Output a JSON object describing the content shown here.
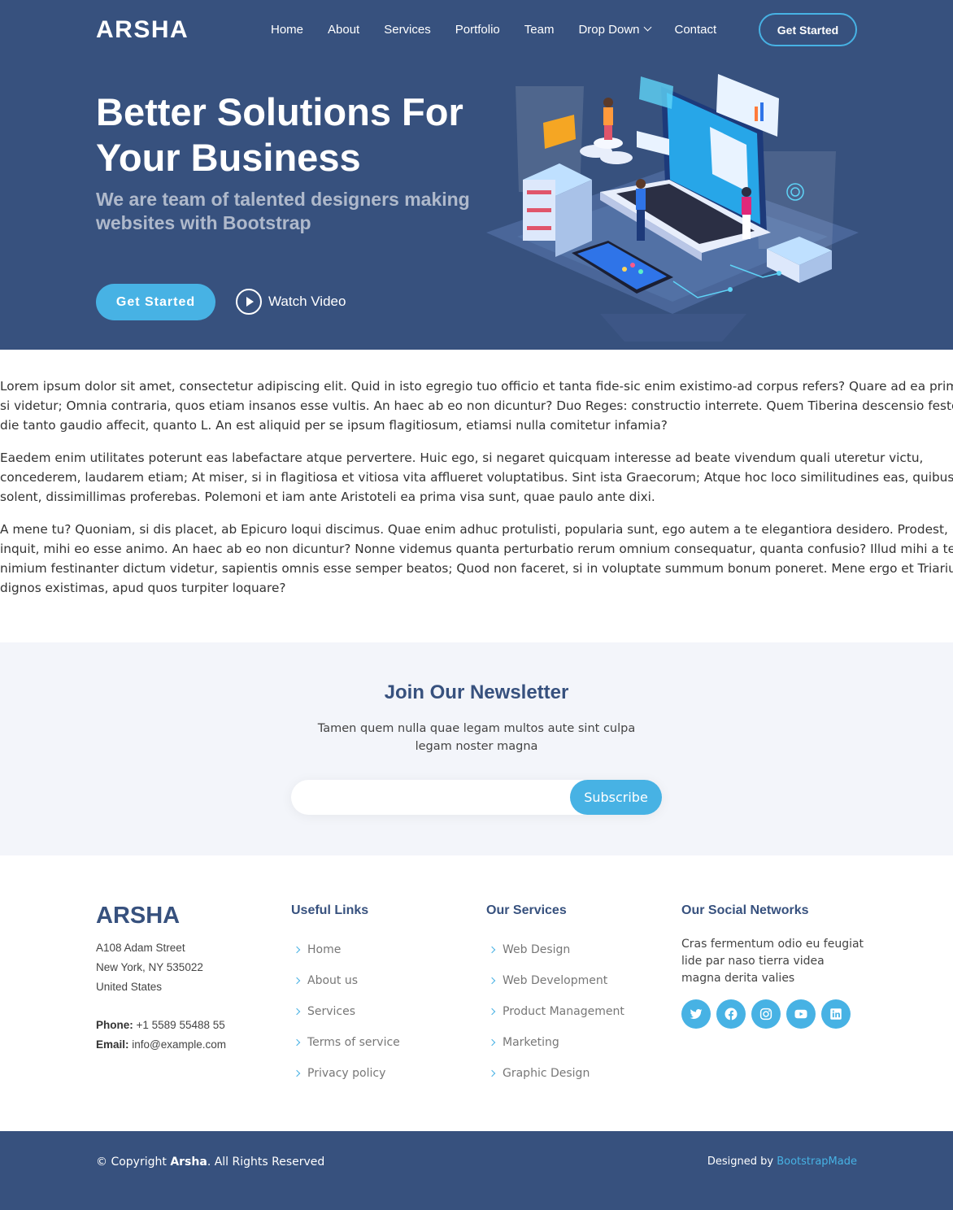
{
  "header": {
    "logo": "ARSHA",
    "nav": [
      {
        "label": "Home"
      },
      {
        "label": "About"
      },
      {
        "label": "Services"
      },
      {
        "label": "Portfolio"
      },
      {
        "label": "Team"
      },
      {
        "label": "Drop Down"
      },
      {
        "label": "Contact"
      }
    ],
    "cta": "Get Started"
  },
  "hero": {
    "title": "Better Solutions For Your Business",
    "subtitle": "We are team of talented designers making websites with Bootstrap",
    "primary_button": "Get Started",
    "video_button": "Watch Video"
  },
  "content": {
    "paragraphs": [
      [
        "Lorem ipsum dolor sit amet, consectetur adipiscing elit. Quid in isto egregio tuo officio et tanta fide-sic enim existimo-ad corpus refers? Quare ad ea primum,",
        "si videtur; Omnia contraria, quos etiam insanos esse vultis. An haec ab eo non dicuntur? Duo Reges: constructio interrete. Quem Tiberina descensio festo illo",
        "die tanto gaudio affecit, quanto L. An est aliquid per se ipsum flagitiosum, etiamsi nulla comitetur infamia?"
      ],
      [
        "Eaedem enim utilitates poterunt eas labefactare atque pervertere. Huic ego, si negaret quicquam interesse ad beate vivendum quali uteretur victu,",
        "concederem, laudarem etiam; At miser, si in flagitiosa et vitiosa vita afflueret voluptatibus. Sint ista Graecorum; Atque hoc loco similitudines eas, quibus illi uti",
        "solent, dissimillimas proferebas. Polemoni et iam ante Aristoteli ea prima visa sunt, quae paulo ante dixi."
      ],
      [
        "A mene tu? Quoniam, si dis placet, ab Epicuro loqui discimus. Quae enim adhuc protulisti, popularia sunt, ego autem a te elegantiora desidero. Prodest,",
        "inquit, mihi eo esse animo. An haec ab eo non dicuntur? Nonne videmus quanta perturbatio rerum omnium consequatur, quanta confusio? Illud mihi a te",
        "nimium festinanter dictum videtur, sapientis omnis esse semper beatos; Quod non faceret, si in voluptate summum bonum poneret. Mene ergo et Triarium",
        "dignos existimas, apud quos turpiter loquare?"
      ]
    ]
  },
  "newsletter": {
    "title": "Join Our Newsletter",
    "text": "Tamen quem nulla quae legam multos aute sint culpa legam noster magna",
    "input_value": "",
    "button": "Subscribe"
  },
  "footer": {
    "logo": "ARSHA",
    "address": [
      "A108 Adam Street",
      "New York, NY 535022",
      "United States"
    ],
    "phone_label": "Phone:",
    "phone": "+1 5589 55488 55",
    "email_label": "Email:",
    "email": "info@example.com",
    "useful_links": {
      "title": "Useful Links",
      "items": [
        "Home",
        "About us",
        "Services",
        "Terms of service",
        "Privacy policy"
      ]
    },
    "services": {
      "title": "Our Services",
      "items": [
        "Web Design",
        "Web Development",
        "Product Management",
        "Marketing",
        "Graphic Design"
      ]
    },
    "social": {
      "title": "Our Social Networks",
      "text": "Cras fermentum odio eu feugiat lide par naso tierra videa magna derita valies",
      "icons": [
        "twitter-icon",
        "facebook-icon",
        "instagram-icon",
        "youtube-icon",
        "linkedin-icon"
      ]
    },
    "copyright_prefix": "© Copyright",
    "copyright_brand": "Arsha",
    "copyright_suffix": ". All Rights Reserved",
    "designed_by": "Designed by",
    "designer": "BootstrapMade"
  },
  "colors": {
    "primary": "#37517e",
    "accent": "#47b2e4",
    "light_bg": "#f3f5fa"
  }
}
